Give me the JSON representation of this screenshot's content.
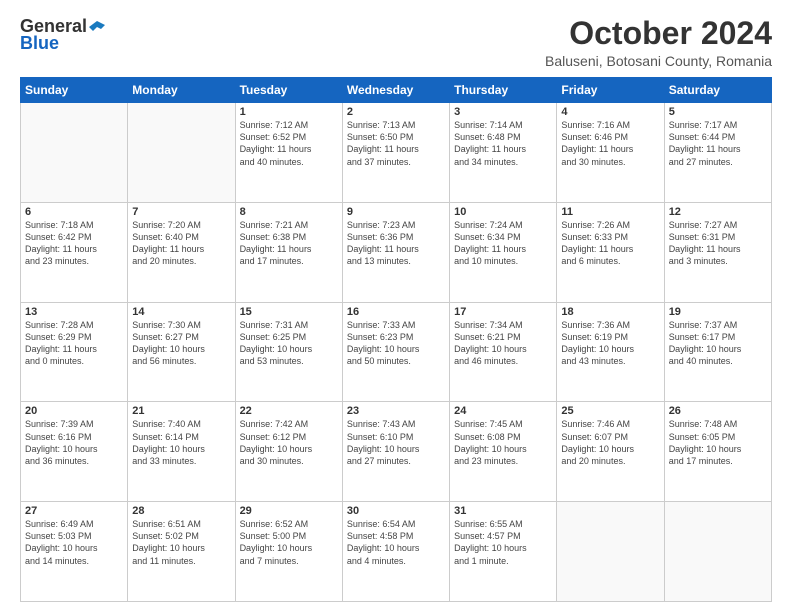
{
  "header": {
    "logo_general": "General",
    "logo_blue": "Blue",
    "month": "October 2024",
    "location": "Baluseni, Botosani County, Romania"
  },
  "days_of_week": [
    "Sunday",
    "Monday",
    "Tuesday",
    "Wednesday",
    "Thursday",
    "Friday",
    "Saturday"
  ],
  "weeks": [
    [
      {
        "day": "",
        "info": ""
      },
      {
        "day": "",
        "info": ""
      },
      {
        "day": "1",
        "info": "Sunrise: 7:12 AM\nSunset: 6:52 PM\nDaylight: 11 hours\nand 40 minutes."
      },
      {
        "day": "2",
        "info": "Sunrise: 7:13 AM\nSunset: 6:50 PM\nDaylight: 11 hours\nand 37 minutes."
      },
      {
        "day": "3",
        "info": "Sunrise: 7:14 AM\nSunset: 6:48 PM\nDaylight: 11 hours\nand 34 minutes."
      },
      {
        "day": "4",
        "info": "Sunrise: 7:16 AM\nSunset: 6:46 PM\nDaylight: 11 hours\nand 30 minutes."
      },
      {
        "day": "5",
        "info": "Sunrise: 7:17 AM\nSunset: 6:44 PM\nDaylight: 11 hours\nand 27 minutes."
      }
    ],
    [
      {
        "day": "6",
        "info": "Sunrise: 7:18 AM\nSunset: 6:42 PM\nDaylight: 11 hours\nand 23 minutes."
      },
      {
        "day": "7",
        "info": "Sunrise: 7:20 AM\nSunset: 6:40 PM\nDaylight: 11 hours\nand 20 minutes."
      },
      {
        "day": "8",
        "info": "Sunrise: 7:21 AM\nSunset: 6:38 PM\nDaylight: 11 hours\nand 17 minutes."
      },
      {
        "day": "9",
        "info": "Sunrise: 7:23 AM\nSunset: 6:36 PM\nDaylight: 11 hours\nand 13 minutes."
      },
      {
        "day": "10",
        "info": "Sunrise: 7:24 AM\nSunset: 6:34 PM\nDaylight: 11 hours\nand 10 minutes."
      },
      {
        "day": "11",
        "info": "Sunrise: 7:26 AM\nSunset: 6:33 PM\nDaylight: 11 hours\nand 6 minutes."
      },
      {
        "day": "12",
        "info": "Sunrise: 7:27 AM\nSunset: 6:31 PM\nDaylight: 11 hours\nand 3 minutes."
      }
    ],
    [
      {
        "day": "13",
        "info": "Sunrise: 7:28 AM\nSunset: 6:29 PM\nDaylight: 11 hours\nand 0 minutes."
      },
      {
        "day": "14",
        "info": "Sunrise: 7:30 AM\nSunset: 6:27 PM\nDaylight: 10 hours\nand 56 minutes."
      },
      {
        "day": "15",
        "info": "Sunrise: 7:31 AM\nSunset: 6:25 PM\nDaylight: 10 hours\nand 53 minutes."
      },
      {
        "day": "16",
        "info": "Sunrise: 7:33 AM\nSunset: 6:23 PM\nDaylight: 10 hours\nand 50 minutes."
      },
      {
        "day": "17",
        "info": "Sunrise: 7:34 AM\nSunset: 6:21 PM\nDaylight: 10 hours\nand 46 minutes."
      },
      {
        "day": "18",
        "info": "Sunrise: 7:36 AM\nSunset: 6:19 PM\nDaylight: 10 hours\nand 43 minutes."
      },
      {
        "day": "19",
        "info": "Sunrise: 7:37 AM\nSunset: 6:17 PM\nDaylight: 10 hours\nand 40 minutes."
      }
    ],
    [
      {
        "day": "20",
        "info": "Sunrise: 7:39 AM\nSunset: 6:16 PM\nDaylight: 10 hours\nand 36 minutes."
      },
      {
        "day": "21",
        "info": "Sunrise: 7:40 AM\nSunset: 6:14 PM\nDaylight: 10 hours\nand 33 minutes."
      },
      {
        "day": "22",
        "info": "Sunrise: 7:42 AM\nSunset: 6:12 PM\nDaylight: 10 hours\nand 30 minutes."
      },
      {
        "day": "23",
        "info": "Sunrise: 7:43 AM\nSunset: 6:10 PM\nDaylight: 10 hours\nand 27 minutes."
      },
      {
        "day": "24",
        "info": "Sunrise: 7:45 AM\nSunset: 6:08 PM\nDaylight: 10 hours\nand 23 minutes."
      },
      {
        "day": "25",
        "info": "Sunrise: 7:46 AM\nSunset: 6:07 PM\nDaylight: 10 hours\nand 20 minutes."
      },
      {
        "day": "26",
        "info": "Sunrise: 7:48 AM\nSunset: 6:05 PM\nDaylight: 10 hours\nand 17 minutes."
      }
    ],
    [
      {
        "day": "27",
        "info": "Sunrise: 6:49 AM\nSunset: 5:03 PM\nDaylight: 10 hours\nand 14 minutes."
      },
      {
        "day": "28",
        "info": "Sunrise: 6:51 AM\nSunset: 5:02 PM\nDaylight: 10 hours\nand 11 minutes."
      },
      {
        "day": "29",
        "info": "Sunrise: 6:52 AM\nSunset: 5:00 PM\nDaylight: 10 hours\nand 7 minutes."
      },
      {
        "day": "30",
        "info": "Sunrise: 6:54 AM\nSunset: 4:58 PM\nDaylight: 10 hours\nand 4 minutes."
      },
      {
        "day": "31",
        "info": "Sunrise: 6:55 AM\nSunset: 4:57 PM\nDaylight: 10 hours\nand 1 minute."
      },
      {
        "day": "",
        "info": ""
      },
      {
        "day": "",
        "info": ""
      }
    ]
  ]
}
